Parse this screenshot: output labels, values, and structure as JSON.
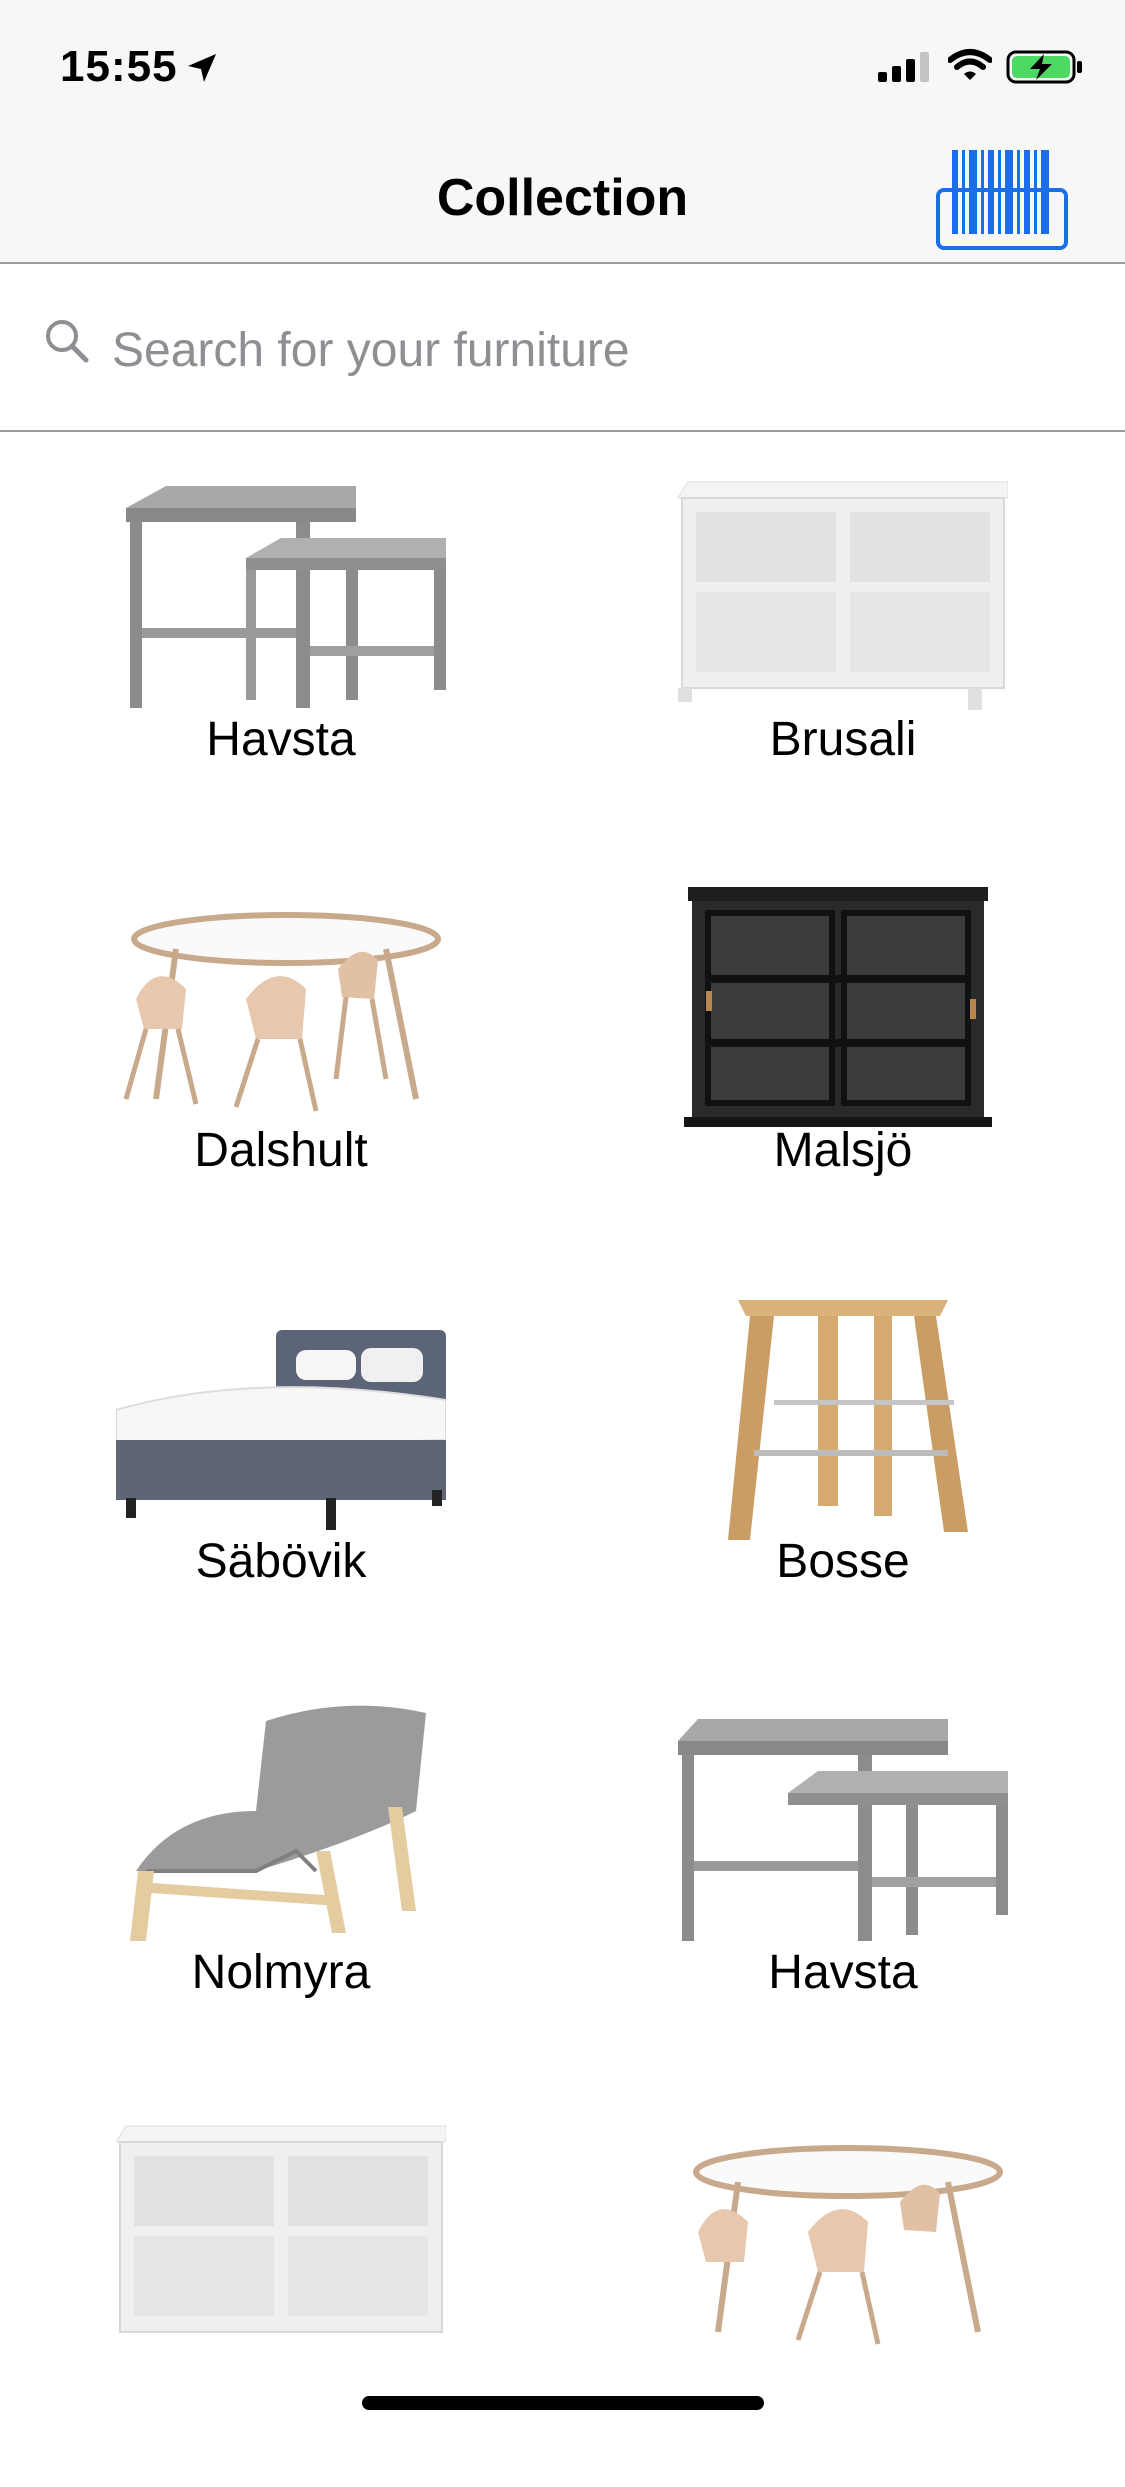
{
  "status_bar": {
    "time": "15:55"
  },
  "nav": {
    "title": "Collection"
  },
  "search": {
    "placeholder": "Search for your furniture",
    "value": ""
  },
  "products": [
    {
      "name": "Havsta",
      "image": "nesting-tables-gray"
    },
    {
      "name": "Brusali",
      "image": "tv-bench-white"
    },
    {
      "name": "Dalshult",
      "image": "dining-set-white-birch"
    },
    {
      "name": "Malsjö",
      "image": "glass-door-cabinet-black"
    },
    {
      "name": "Säbövik",
      "image": "bed-gray-white-linen"
    },
    {
      "name": "Bosse",
      "image": "bar-stool-wood"
    },
    {
      "name": "Nolmyra",
      "image": "easy-chair-gray-birch"
    },
    {
      "name": "Havsta",
      "image": "nesting-tables-gray"
    },
    {
      "name": "",
      "image": "tv-bench-white"
    },
    {
      "name": "",
      "image": "dining-set-white-birch"
    }
  ],
  "colors": {
    "accent": "#1a6ee6",
    "battery_fill": "#4cd964",
    "bar_bg": "#f7f7f7",
    "separator": "#9a9a9a",
    "placeholder": "#8e8e93"
  }
}
